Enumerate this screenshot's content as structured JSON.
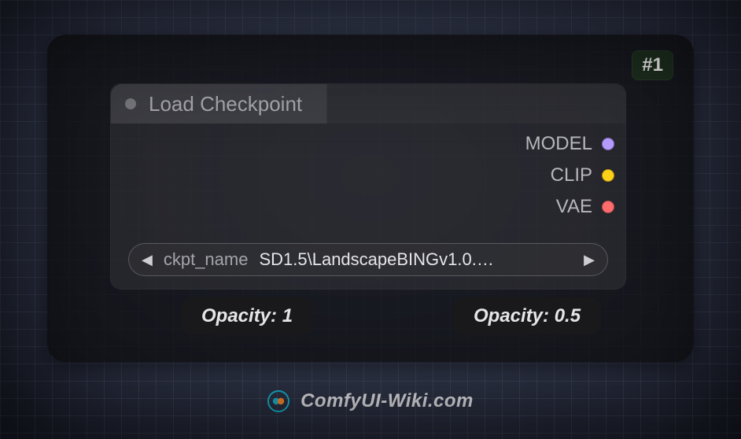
{
  "badge": "#1",
  "node": {
    "title": "Load Checkpoint",
    "outputs": [
      {
        "label": "MODEL",
        "color": "#b79cff"
      },
      {
        "label": "CLIP",
        "color": "#ffd21a"
      },
      {
        "label": "VAE",
        "color": "#ff6d6d"
      }
    ],
    "widget": {
      "key": "ckpt_name",
      "value": "SD1.5\\LandscapeBINGv1.0.…"
    }
  },
  "pills": {
    "left": "Opacity: 1",
    "right": "Opacity: 0.5"
  },
  "watermark": "ComfyUI-Wiki.com"
}
